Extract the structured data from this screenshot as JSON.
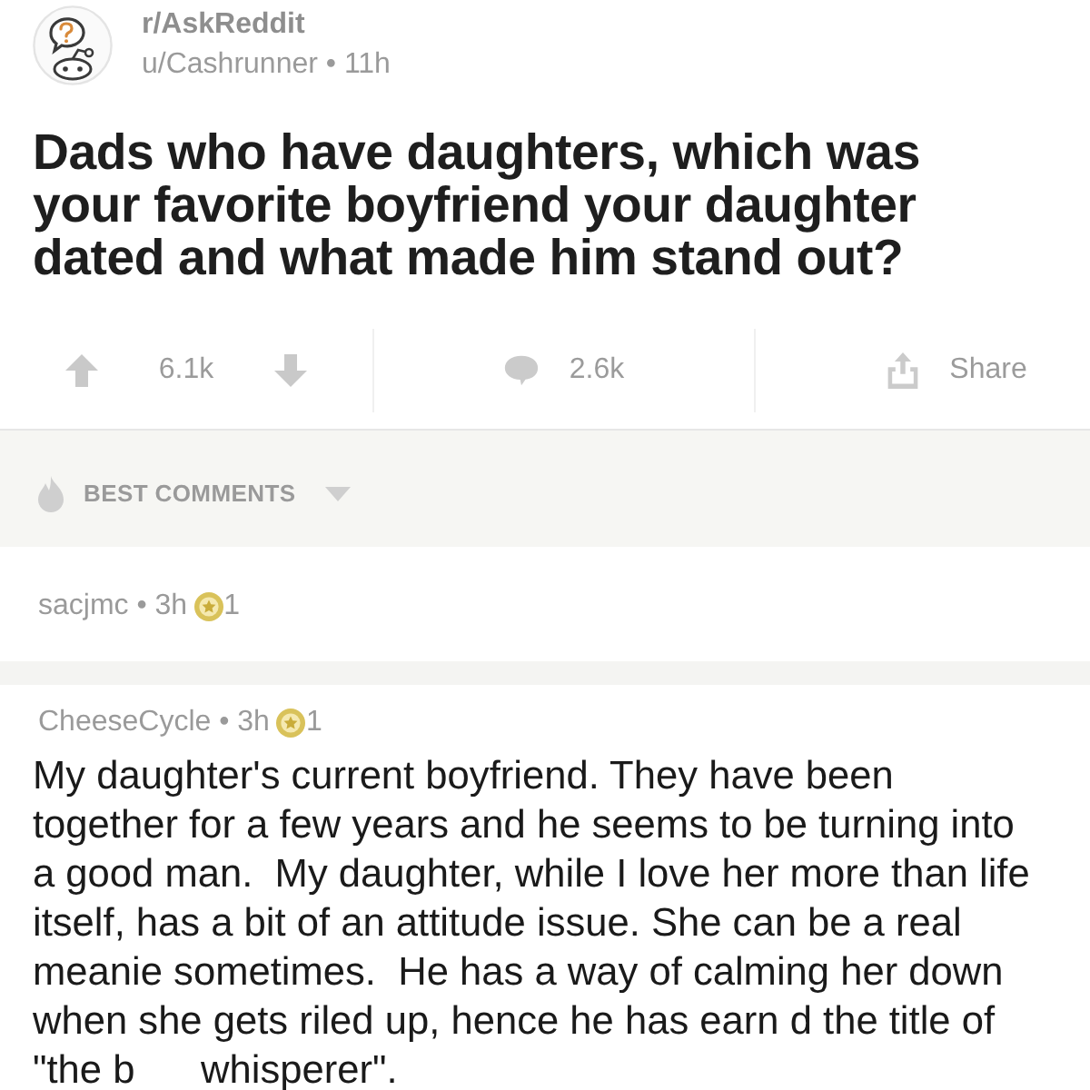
{
  "post": {
    "subreddit": "r/AskReddit",
    "meta": "u/Cashrunner • 11h",
    "title": "Dads who have daughters, which was your favorite boyfriend your daughter dated and what made him stand out?"
  },
  "actions": {
    "score": "6.1k",
    "comments": "2.6k",
    "share": "Share"
  },
  "sort": {
    "label": "BEST COMMENTS"
  },
  "comments": [
    {
      "meta": "sacjmc • 3h",
      "awards": "1"
    },
    {
      "meta": "CheeseCycle • 3h",
      "awards": "1",
      "body": "My daughter's current boyfriend. They have been together for a few years and he seems to be turning into a good man.  My daughter, while I love her more than life itself, has a bit of an attitude issue. She can be a real meanie sometimes.  He has a way of calming her down when she gets riled up, hence he has earn d the title of \"the b      whisperer\"."
    }
  ]
}
